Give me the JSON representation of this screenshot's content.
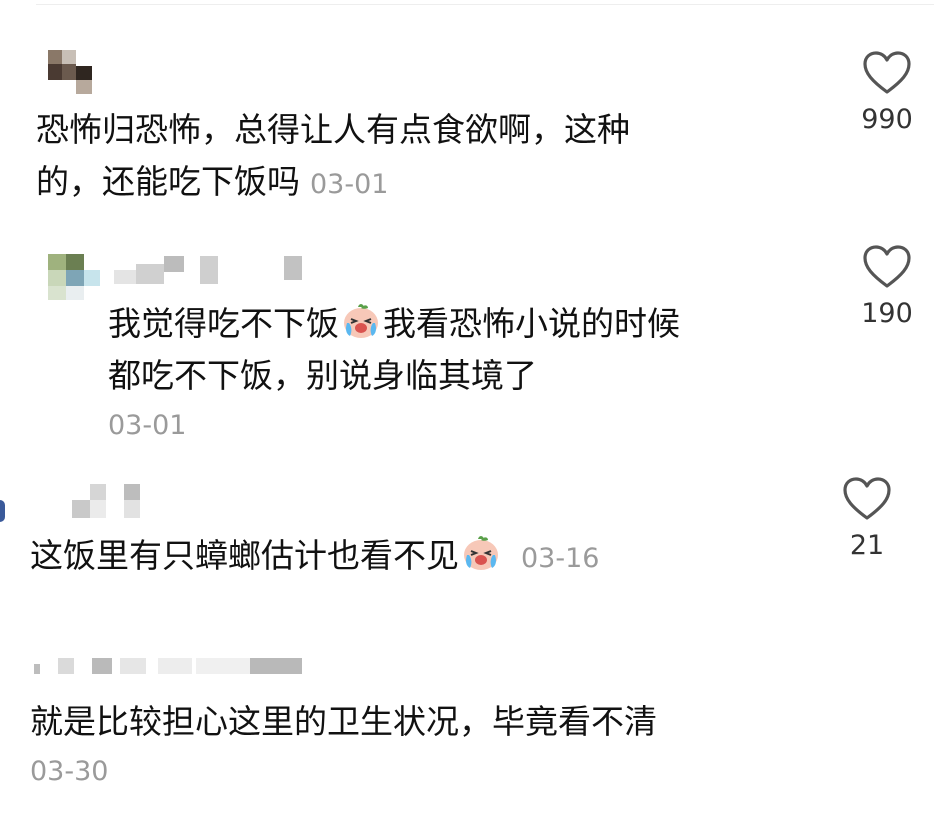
{
  "comments": [
    {
      "segments": [
        "恐怖归恐怖，总得让人有点食欲啊，这种",
        "的，还能吃下饭吗"
      ],
      "timestamp": "03-01",
      "like_count": "990"
    },
    {
      "segments": [
        "我觉得吃不下饭",
        "我看恐怖小说的时候",
        "都吃不下饭，别说身临其境了"
      ],
      "timestamp": "03-01",
      "like_count": "190"
    },
    {
      "segments": [
        "这饭里有只蟑螂估计也看不见"
      ],
      "timestamp": "03-16",
      "like_count": "21"
    },
    {
      "segments": [
        "就是比较担心这里的卫生状况，毕竟看不清"
      ],
      "timestamp": "03-30"
    }
  ],
  "icons": {
    "like": "heart-outline-icon",
    "emoji": "crying-laughing-emoji"
  },
  "colors": {
    "text": "#111111",
    "timestamp": "#9a9a9a",
    "heart_stroke": "#555555",
    "emoji_face": "#f7c8b8"
  }
}
